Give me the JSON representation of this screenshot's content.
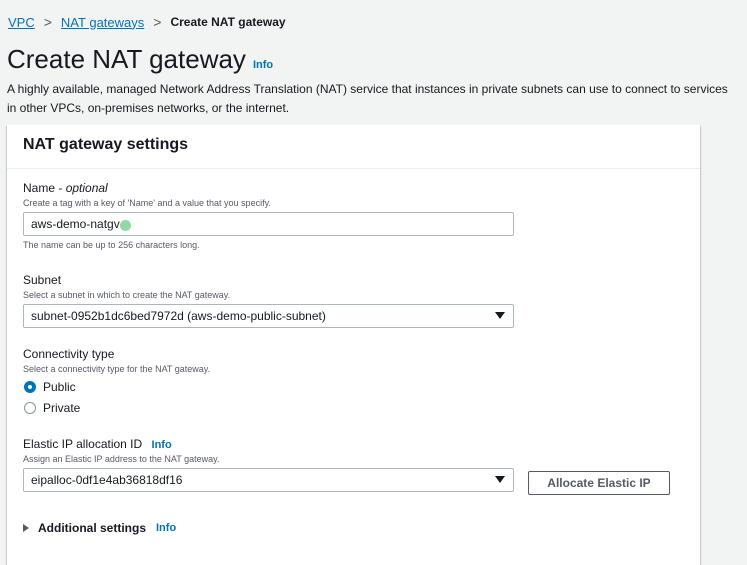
{
  "breadcrumb": {
    "items": [
      "VPC",
      "NAT gateways"
    ],
    "current": "Create NAT gateway"
  },
  "page": {
    "title": "Create NAT gateway",
    "info": "Info",
    "description": "A highly available, managed Network Address Translation (NAT) service that instances in private subnets can use to connect to services in other VPCs, on-premises networks, or the internet."
  },
  "panel": {
    "title": "NAT gateway settings"
  },
  "name_field": {
    "label": "Name - ",
    "label_optional": "optional",
    "hint": "Create a tag with a key of 'Name' and a value that you specify.",
    "value": "aws-demo-natgv",
    "constraint": "The name can be up to 256 characters long."
  },
  "subnet_field": {
    "label": "Subnet",
    "hint": "Select a subnet in which to create the NAT gateway.",
    "value": "subnet-0952b1dc6bed7972d (aws-demo-public-subnet)"
  },
  "connectivity": {
    "label": "Connectivity type",
    "hint": "Select a connectivity type for the NAT gateway.",
    "options": [
      {
        "label": "Public",
        "selected": true
      },
      {
        "label": "Private",
        "selected": false
      }
    ]
  },
  "eip": {
    "label": "Elastic IP allocation ID",
    "info": "Info",
    "hint": "Assign an Elastic IP address to the NAT gateway.",
    "value": "eipalloc-0df1e4ab36818df16",
    "button": "Allocate Elastic IP"
  },
  "additional": {
    "label": "Additional settings",
    "info": "Info"
  },
  "colors": {
    "link": "#0073bb",
    "background": "#f2f3f3",
    "panel": "#ffffff",
    "text": "#16191f"
  }
}
